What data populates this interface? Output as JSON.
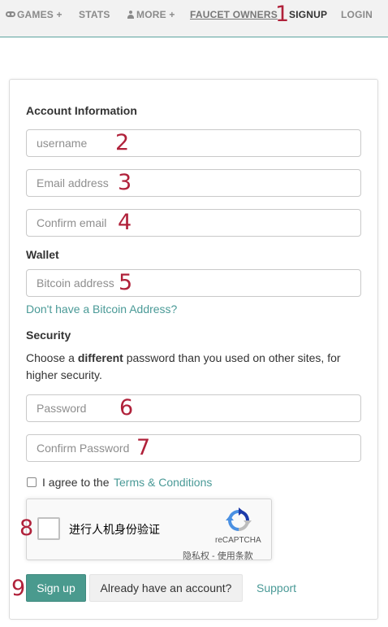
{
  "nav": {
    "games": "GAMES +",
    "stats": "STATS",
    "more": "MORE +",
    "faucet_owners": "FAUCET OWNERS",
    "signup": "SIGNUP",
    "login": "LOGIN"
  },
  "annotations": [
    "1",
    "2",
    "3",
    "4",
    "5",
    "6",
    "7",
    "8",
    "9"
  ],
  "form": {
    "account_heading": "Account Information",
    "username_placeholder": "username",
    "email_placeholder": "Email address",
    "confirm_email_placeholder": "Confirm email",
    "wallet_heading": "Wallet",
    "bitcoin_placeholder": "Bitcoin address",
    "no_bitcoin_link": "Don't have a Bitcoin Address?",
    "security_heading": "Security",
    "security_text_1": "Choose a ",
    "security_text_bold": "different",
    "security_text_2": " password than you used on other sites, for higher security.",
    "password_placeholder": "Password",
    "confirm_password_placeholder": "Confirm Password",
    "agree_text": "I agree to the ",
    "terms_link": "Terms & Conditions"
  },
  "captcha": {
    "label": "进行人机身份验证",
    "brand": "reCAPTCHA",
    "links": "隐私权 - 使用条款"
  },
  "actions": {
    "signup_button": "Sign up",
    "have_account_button": "Already have an account?",
    "support_link": "Support"
  },
  "colors": {
    "accent": "#4a9a8e",
    "annotation": "#b0213a"
  }
}
